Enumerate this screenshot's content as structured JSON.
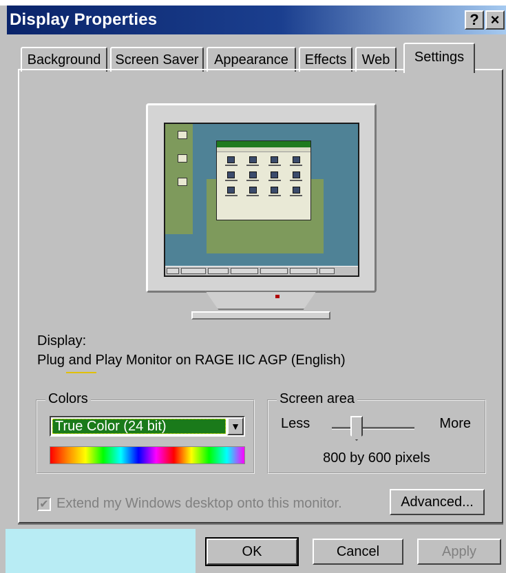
{
  "window": {
    "title": "Display Properties",
    "help_label": "?",
    "close_label": "×"
  },
  "tabs": [
    {
      "label": "Background"
    },
    {
      "label": "Screen Saver"
    },
    {
      "label": "Appearance"
    },
    {
      "label": "Effects"
    },
    {
      "label": "Web"
    },
    {
      "label": "Settings",
      "active": true
    }
  ],
  "display": {
    "label": "Display:",
    "value": "Plug and Play Monitor on RAGE IIC AGP (English)"
  },
  "colors": {
    "legend": "Colors",
    "selected": "True Color (24 bit)",
    "dropdown_icon": "chevron-down-icon"
  },
  "screen_area": {
    "legend": "Screen area",
    "less_label": "Less",
    "more_label": "More",
    "resolution": "800 by 600 pixels",
    "slider_level": 0.3
  },
  "extend": {
    "label": "Extend my Windows desktop onto this monitor.",
    "checked": true,
    "check_glyph": "✔"
  },
  "buttons": {
    "advanced": "Advanced...",
    "ok": "OK",
    "cancel": "Cancel",
    "apply": "Apply"
  }
}
